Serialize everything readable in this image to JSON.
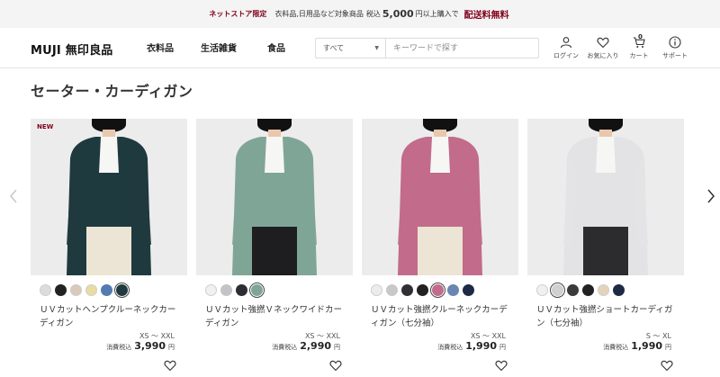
{
  "banner": {
    "lead": "ネットストア限定",
    "text1": "衣料品,日用品など対象商品",
    "tax": "税込",
    "amount": "5,000",
    "text2": "円以上購入で",
    "free": "配送料無料"
  },
  "header": {
    "logo": "MUJI 無印良品",
    "nav": [
      "衣料品",
      "生活雑貨",
      "食品"
    ],
    "search": {
      "category": "すべて",
      "placeholder": "キーワードで探す"
    },
    "utils": {
      "login": "ログイン",
      "favorites": "お気に入り",
      "cart": "カート",
      "cart_count": "0",
      "support": "サポート"
    }
  },
  "page_title": "セーター・カーディガン",
  "products": [
    {
      "badge": "NEW",
      "name": "ＵＶカットヘンプクルーネックカーディガン",
      "size": "XS ～ XXL",
      "tax_label": "消費税込",
      "price": "3,990",
      "currency": "円",
      "garment_color": "#1f3a3e",
      "swatches": [
        "#dcdcdc",
        "#222222",
        "#d8c9b8",
        "#e9dba4",
        "#527bb0",
        "#1f3a3e"
      ],
      "selected": 5
    },
    {
      "badge": "",
      "name": "ＵＶカット強撚Ｖネックワイドカーディガン",
      "size": "XS ～ XXL",
      "tax_label": "消費税込",
      "price": "2,990",
      "currency": "円",
      "garment_color": "#7fa597",
      "swatches": [
        "#f0f0f0",
        "#c3c4c6",
        "#2b2d33",
        "#7fa597"
      ],
      "selected": 3
    },
    {
      "badge": "",
      "name": "ＵＶカット強撚クルーネックカーディガン（七分袖）",
      "size": "XS ～ XXL",
      "tax_label": "消費税込",
      "price": "1,990",
      "currency": "円",
      "garment_color": "#c26b8a",
      "swatches": [
        "#ececec",
        "#c8c8ca",
        "#2e3036",
        "#222222",
        "#c26b8a",
        "#6b86b3",
        "#1e2a45"
      ],
      "selected": 4
    },
    {
      "badge": "",
      "name": "ＵＶカット強撚ショートカーディガン（七分袖）",
      "size": "S ～ XL",
      "tax_label": "消費税込",
      "price": "1,990",
      "currency": "円",
      "garment_color": "#e3e3e5",
      "swatches": [
        "#f0f0f0",
        "#d0d0d2",
        "#3a3a3c",
        "#222222",
        "#e2d4b8",
        "#1e2a45"
      ],
      "selected": 1
    }
  ]
}
